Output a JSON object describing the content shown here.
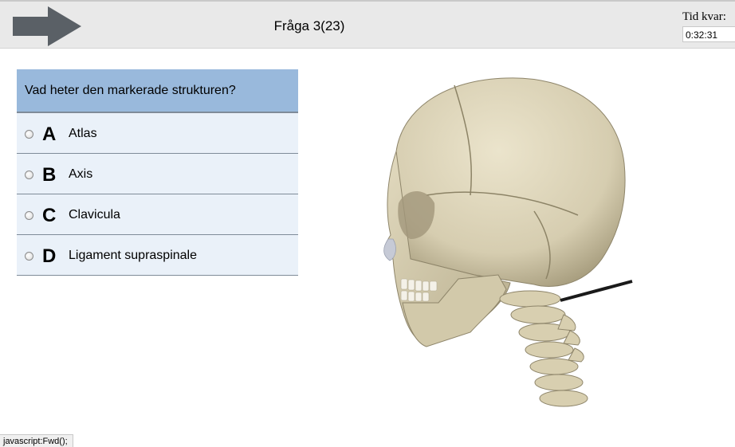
{
  "header": {
    "next_icon": "arrow-right-icon",
    "question_counter": "Fråga 3(23)",
    "timer_label": "Tid kvar:",
    "timer_value": "0:32:31"
  },
  "question": {
    "text": "Vad heter den markerade strukturen?",
    "options": [
      {
        "letter": "A",
        "text": "Atlas"
      },
      {
        "letter": "B",
        "text": "Axis"
      },
      {
        "letter": "C",
        "text": "Clavicula"
      },
      {
        "letter": "D",
        "text": "Ligament supraspinale"
      }
    ]
  },
  "colors": {
    "question_header": "#99b9dc",
    "option_background": "#eaf1f9",
    "arrow": "#5a6066",
    "bone": "#d9d0b4"
  },
  "status_bar": {
    "text": "javascript:Fwd();"
  }
}
